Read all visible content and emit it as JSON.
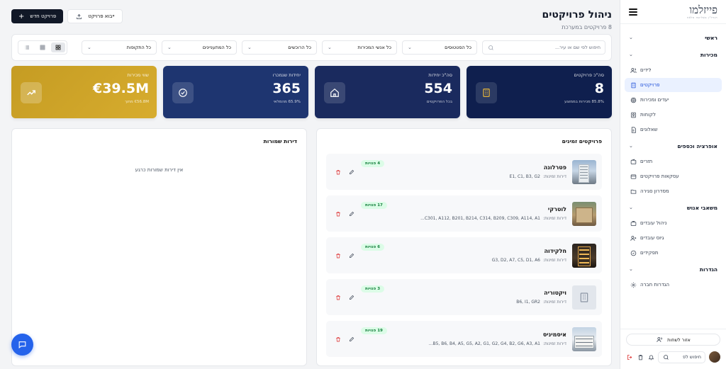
{
  "sidebar": {
    "logo": "פייזלמו",
    "logo_tagline": "הנדל\"ן בשליטה מלאה",
    "groups": [
      {
        "label": "ראשי",
        "items": []
      },
      {
        "label": "מכירות",
        "items": [
          {
            "label": "לידים",
            "icon": "users-icon",
            "active": false
          },
          {
            "label": "פרויקטים",
            "icon": "building-icon",
            "active": true
          },
          {
            "label": "יעדים ומכירות",
            "icon": "target-icon",
            "active": false
          },
          {
            "label": "לקוחות",
            "icon": "contact-icon",
            "active": false
          },
          {
            "label": "שאלונים",
            "icon": "document-icon",
            "active": false
          }
        ]
      },
      {
        "label": "אופרציה וכספים",
        "items": [
          {
            "label": "תזרים",
            "icon": "wallet-icon",
            "active": false
          },
          {
            "label": "עסקאות פרויקטים",
            "icon": "deal-icon",
            "active": false
          },
          {
            "label": "מסדרון סגירה",
            "icon": "folder-icon",
            "active": false
          }
        ]
      },
      {
        "label": "משאבי אנוש",
        "items": [
          {
            "label": "ניהול עובדים",
            "icon": "briefcase-icon",
            "active": false
          },
          {
            "label": "גיוס עובדים",
            "icon": "user-add-icon",
            "active": false
          },
          {
            "label": "תפקידים",
            "icon": "roles-icon",
            "active": false
          }
        ]
      },
      {
        "label": "הגדרות",
        "items": [
          {
            "label": "הגדרות חברה",
            "icon": "settings-icon",
            "active": false
          }
        ]
      }
    ],
    "logout_label": "אזור לשחות",
    "search_me_label": "חיפוש לפ"
  },
  "header": {
    "title": "ניהול פרויקטים",
    "subtitle": "8 פרויקטים במערכת",
    "new_project_label": "פרויקט חדש",
    "import_label": "ייבוא פרויקט"
  },
  "filters": {
    "search_placeholder": "חיפוש לפי שם או עיר...",
    "statuses": "כל הסטטוסים",
    "salespeople": "כל אנשי המכירות",
    "buyers": "כל הרוכשים",
    "interested": "כל המתעניינים",
    "periods": "כל התקופות"
  },
  "stats": [
    {
      "label": "סה\"כ פרויקטים",
      "value": "8",
      "sub": "85.8% מכירות בממוצע",
      "icon": "building-icon"
    },
    {
      "label": "סה\"כ יחידות",
      "value": "554",
      "sub": "בכל הפרויקטים",
      "icon": "home-icon"
    },
    {
      "label": "יחידות שנמכרו",
      "value": "365",
      "sub": "65.9% מהמלאי",
      "icon": "check-circle-icon"
    },
    {
      "label": "שווי מכירות",
      "value": "€39.5M",
      "sub": "€56.8M מתוך",
      "icon": "trending-up-icon"
    }
  ],
  "projects_panel": {
    "title": "פרויקטים זמינים",
    "units_label": "דירות זמינות:",
    "items": [
      {
        "name": "פטרלונה",
        "units": "E1, C1, B3, G2",
        "badge": "4 פנויות"
      },
      {
        "name": "לוטרקי",
        "units": "C301, A112, B201, B214, C314, B209, C309, A114, A1...",
        "badge": "17 פנויות"
      },
      {
        "name": "חלקידוה",
        "units": "G3, D2, A7, C5, D1, A6",
        "badge": "6 פנויות"
      },
      {
        "name": "ויקטוריה",
        "units": "B6, I1, GR2",
        "badge": "3 פנויות"
      },
      {
        "name": "איסמיניס",
        "units": "B5, B6, B4, A5, G5, A2, G1, G2, G4, B2, G6, A3, A1...",
        "badge": "19 פנויות"
      }
    ]
  },
  "saved_panel": {
    "title": "דירות שמורות",
    "empty": "אין דירות שמורות כרגע"
  }
}
